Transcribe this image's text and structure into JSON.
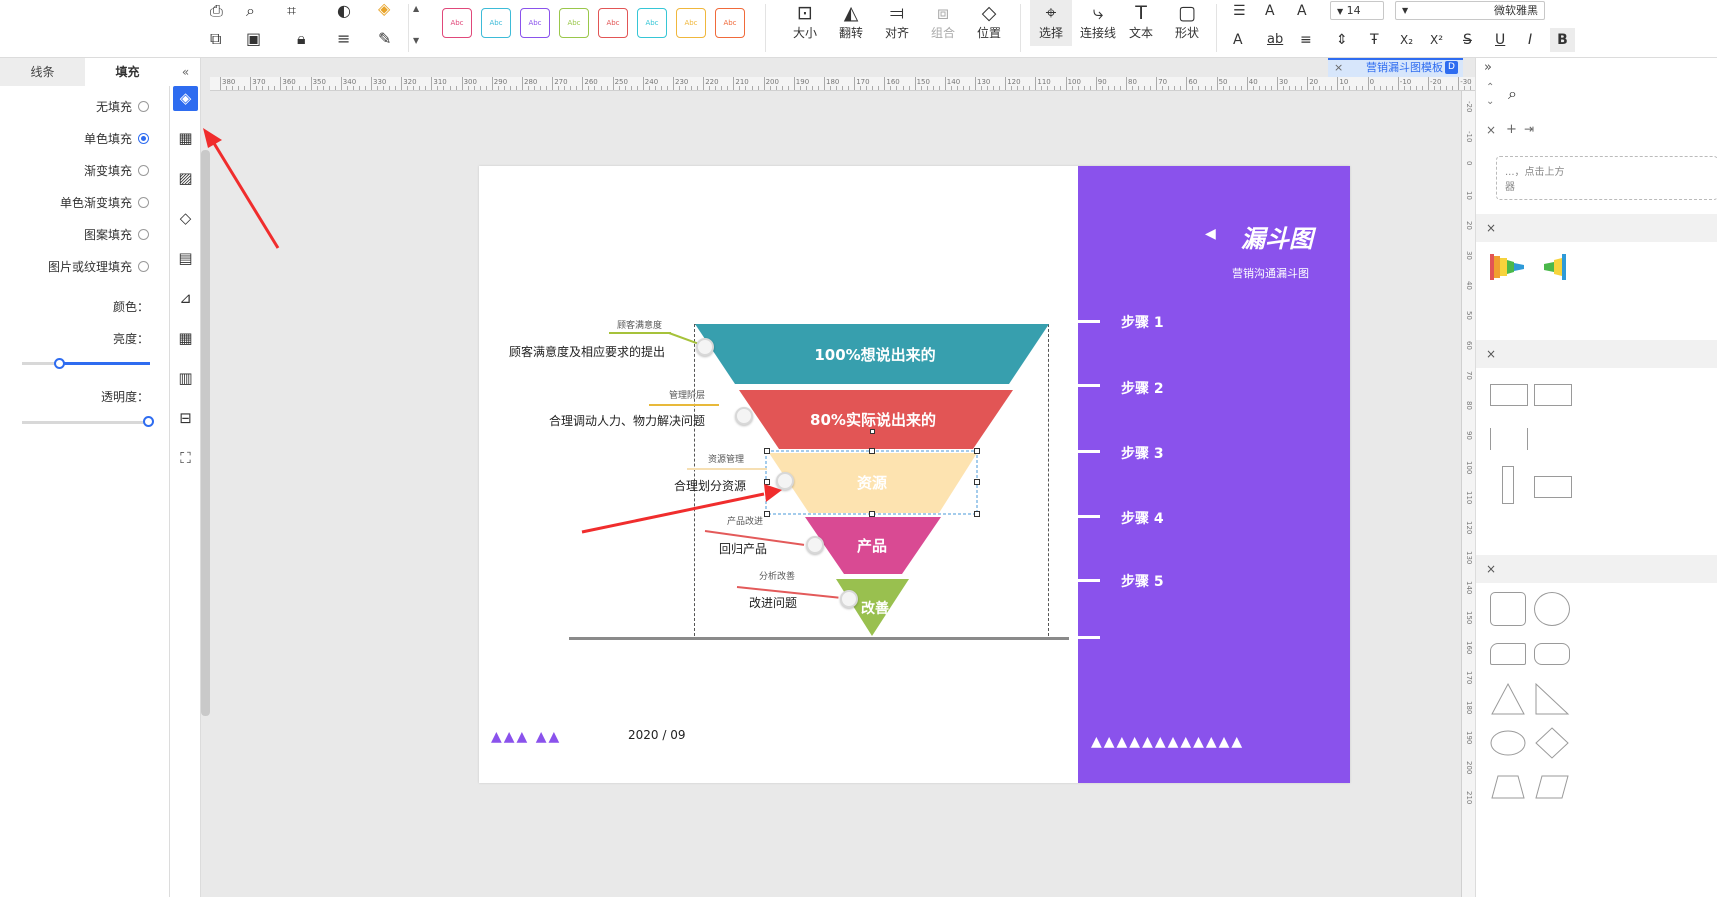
{
  "toolbar": {
    "style_swatches": [
      "Abc",
      "Abc",
      "Abc",
      "Abc",
      "Abc",
      "Abc",
      "Abc",
      "Abc"
    ],
    "buttons": {
      "size": "大小",
      "flip": "翻转",
      "align": "对齐",
      "group": "组合",
      "position": "位置",
      "select": "选择",
      "connector": "连接线",
      "text": "文本",
      "shape": "形状"
    },
    "font_size": "14",
    "font_family": "微软雅黑"
  },
  "left_panel": {
    "tabs": {
      "fill": "填充",
      "line": "线条"
    },
    "fill_options": [
      "无填充",
      "单色填充",
      "渐变填充",
      "单色渐变填充",
      "图案填充",
      "图片或纹理填充"
    ],
    "selected_fill": 1,
    "labels": {
      "color": "颜色：",
      "brightness": "亮度：",
      "transparency": "透明度："
    },
    "brightness_value": 0.71,
    "transparency_value": 0.0
  },
  "document_tab": {
    "title": "营销漏斗图模板"
  },
  "ruler": {
    "horizontal": [
      "380",
      "370",
      "360",
      "350",
      "340",
      "330",
      "320",
      "310",
      "300",
      "290",
      "280",
      "270",
      "260",
      "250",
      "240",
      "230",
      "220",
      "210",
      "200",
      "190",
      "180",
      "170",
      "160",
      "150",
      "140",
      "130",
      "120",
      "110",
      "100",
      "90",
      "80",
      "70",
      "60",
      "50",
      "40",
      "30",
      "20",
      "10",
      "0",
      "-10",
      "-20",
      "-30"
    ],
    "vertical": [
      "-20",
      "-10",
      "0",
      "10",
      "20",
      "30",
      "40",
      "50",
      "60",
      "70",
      "80",
      "90",
      "100",
      "110",
      "120",
      "130",
      "140",
      "150",
      "160",
      "170",
      "180",
      "190",
      "200",
      "210"
    ]
  },
  "page": {
    "title": "漏斗图",
    "subtitle": "营销沟通漏斗图",
    "steps": [
      "步骤 1",
      "步骤 2",
      "步骤 3",
      "步骤 4",
      "步骤 5"
    ],
    "date": "2020 / 09",
    "funnel": [
      {
        "label": "100%想说出来的",
        "color": "#379fae"
      },
      {
        "label": "80%实际说出来的",
        "color": "#e25555"
      },
      {
        "label": "资源",
        "color": "#fde3b0"
      },
      {
        "label": "产品",
        "color": "#d94a93"
      },
      {
        "label": "改善",
        "color": "#99c04f"
      }
    ],
    "callouts": [
      {
        "title": "顾客满意度",
        "desc": "顾客满意度及相应要求的提出",
        "color": "#a6c23a"
      },
      {
        "title": "管理阶层",
        "desc": "合理调动人力、物力解决问题",
        "color": "#e8b93a"
      },
      {
        "title": "资源管理",
        "desc": "合理划分资源",
        "color": "#f6dfb3"
      },
      {
        "title": "产品改进",
        "desc": "回归产品",
        "color": "#e35a5a"
      },
      {
        "title": "分析改善",
        "desc": "改进问题",
        "color": "#e35a5a"
      }
    ]
  },
  "right_panel": {
    "drop_hint": "...，点击上方",
    "drop_hint2": "器"
  },
  "colors": {
    "accent": "#2e6cf0",
    "purple": "#8a52ec",
    "arrow": "#f02d2d"
  }
}
